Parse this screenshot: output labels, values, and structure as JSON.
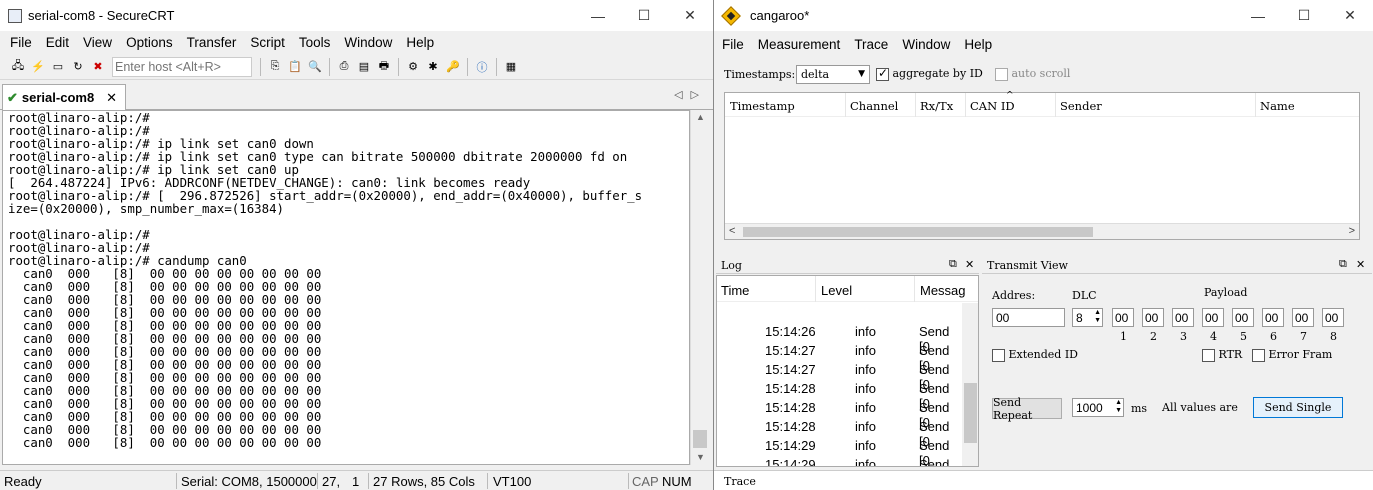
{
  "securecrt": {
    "title": "serial-com8 - SecureCRT",
    "menu": [
      "File",
      "Edit",
      "View",
      "Options",
      "Transfer",
      "Script",
      "Tools",
      "Window",
      "Help"
    ],
    "host_placeholder": "Enter host <Alt+R>",
    "tab_label": "serial-com8",
    "terminal_lines": [
      "root@linaro-alip:/#",
      "root@linaro-alip:/#",
      "root@linaro-alip:/# ip link set can0 down",
      "root@linaro-alip:/# ip link set can0 type can bitrate 500000 dbitrate 2000000 fd on",
      "root@linaro-alip:/# ip link set can0 up",
      "[  264.487224] IPv6: ADDRCONF(NETDEV_CHANGE): can0: link becomes ready",
      "root@linaro-alip:/# [  296.872526] start_addr=(0x20000), end_addr=(0x40000), buffer_s",
      "ize=(0x20000), smp_number_max=(16384)",
      "",
      "root@linaro-alip:/#",
      "root@linaro-alip:/#",
      "root@linaro-alip:/# candump can0",
      "  can0  000   [8]  00 00 00 00 00 00 00 00",
      "  can0  000   [8]  00 00 00 00 00 00 00 00",
      "  can0  000   [8]  00 00 00 00 00 00 00 00",
      "  can0  000   [8]  00 00 00 00 00 00 00 00",
      "  can0  000   [8]  00 00 00 00 00 00 00 00",
      "  can0  000   [8]  00 00 00 00 00 00 00 00",
      "  can0  000   [8]  00 00 00 00 00 00 00 00",
      "  can0  000   [8]  00 00 00 00 00 00 00 00",
      "  can0  000   [8]  00 00 00 00 00 00 00 00",
      "  can0  000   [8]  00 00 00 00 00 00 00 00",
      "  can0  000   [8]  00 00 00 00 00 00 00 00",
      "  can0  000   [8]  00 00 00 00 00 00 00 00",
      "  can0  000   [8]  00 00 00 00 00 00 00 00",
      "  can0  000   [8]  00 00 00 00 00 00 00 00"
    ],
    "status": {
      "ready": "Ready",
      "serial": "Serial: COM8, 1500000",
      "row": "27,",
      "col": "1",
      "size": "27 Rows, 85 Cols",
      "emulation": "VT100",
      "cap": "CAP",
      "num": "NUM"
    }
  },
  "cangaroo": {
    "title": "cangaroo*",
    "menu": [
      "File",
      "Measurement",
      "Trace",
      "Window",
      "Help"
    ],
    "timestamps_label": "Timestamps:",
    "timestamps_value": "delta",
    "aggregate_label": "aggregate by ID",
    "aggregate_checked": true,
    "autoscroll_label": "auto scroll",
    "autoscroll_checked": false,
    "trace_columns": [
      "Timestamp",
      "Channel",
      "Rx/Tx",
      "CAN ID",
      "Sender",
      "Name"
    ],
    "log_title": "Log",
    "log_columns": [
      "Time",
      "Level",
      "Messag"
    ],
    "log_rows": [
      {
        "time": "15:14:26",
        "level": "info",
        "msg": "Send [0"
      },
      {
        "time": "15:14:27",
        "level": "info",
        "msg": "Send [0"
      },
      {
        "time": "15:14:27",
        "level": "info",
        "msg": "Send [0"
      },
      {
        "time": "15:14:28",
        "level": "info",
        "msg": "Send [0"
      },
      {
        "time": "15:14:28",
        "level": "info",
        "msg": "Send [0"
      },
      {
        "time": "15:14:28",
        "level": "info",
        "msg": "Send [0"
      },
      {
        "time": "15:14:29",
        "level": "info",
        "msg": "Send [0"
      },
      {
        "time": "15:14:29",
        "level": "info",
        "msg": "Send [0"
      }
    ],
    "transmit": {
      "title": "Transmit View",
      "address_label": "Addres:",
      "address_value": "00",
      "dlc_label": "DLC",
      "dlc_value": "8",
      "payload_label": "Payload",
      "payload_values": [
        "00",
        "00",
        "00",
        "00",
        "00",
        "00",
        "00",
        "00"
      ],
      "payload_indices": [
        "1",
        "2",
        "3",
        "4",
        "5",
        "6",
        "7",
        "8"
      ],
      "extended_label": "Extended ID",
      "rtr_label": "RTR",
      "error_label": "Error Fram",
      "send_repeat_label": "Send Repeat",
      "interval_value": "1000",
      "ms_label": "ms",
      "all_values_label": "All values are",
      "send_single_label": "Send Single"
    },
    "bottom_tab": "Trace"
  }
}
